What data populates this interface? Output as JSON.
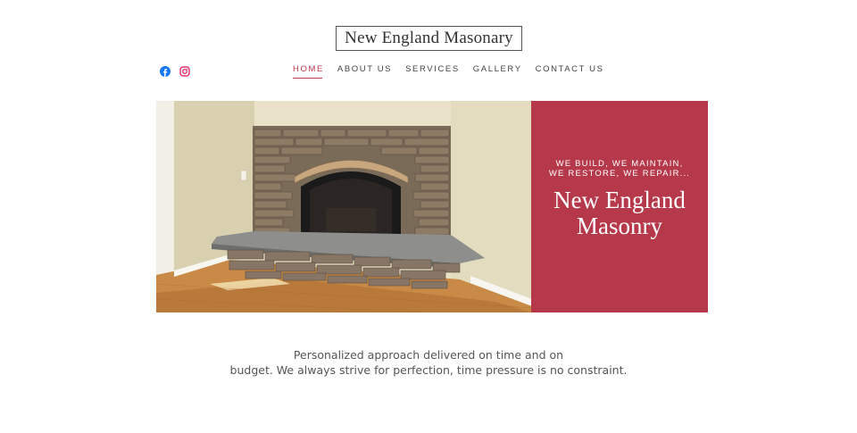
{
  "brand": {
    "name": "New England Masonary"
  },
  "social": [
    {
      "icon": "facebook-icon",
      "color": "#1877f2"
    },
    {
      "icon": "instagram-icon",
      "color": "#e1306c"
    }
  ],
  "nav": {
    "items": [
      {
        "label": "HOME",
        "active": true
      },
      {
        "label": "ABOUT US",
        "active": false
      },
      {
        "label": "SERVICES",
        "active": false
      },
      {
        "label": "GALLERY",
        "active": false
      },
      {
        "label": "CONTACT US",
        "active": false
      }
    ]
  },
  "hero": {
    "tagline": "WE BUILD, WE MAINTAIN, WE RESTORE, WE REPAIR...",
    "title_line1": "New England",
    "title_line2": "Masonry",
    "panel_color": "#b5384b"
  },
  "intro": {
    "line1": "Personalized approach delivered on time and on",
    "line2": "budget. We always strive for perfection, time pressure is no constraint."
  }
}
